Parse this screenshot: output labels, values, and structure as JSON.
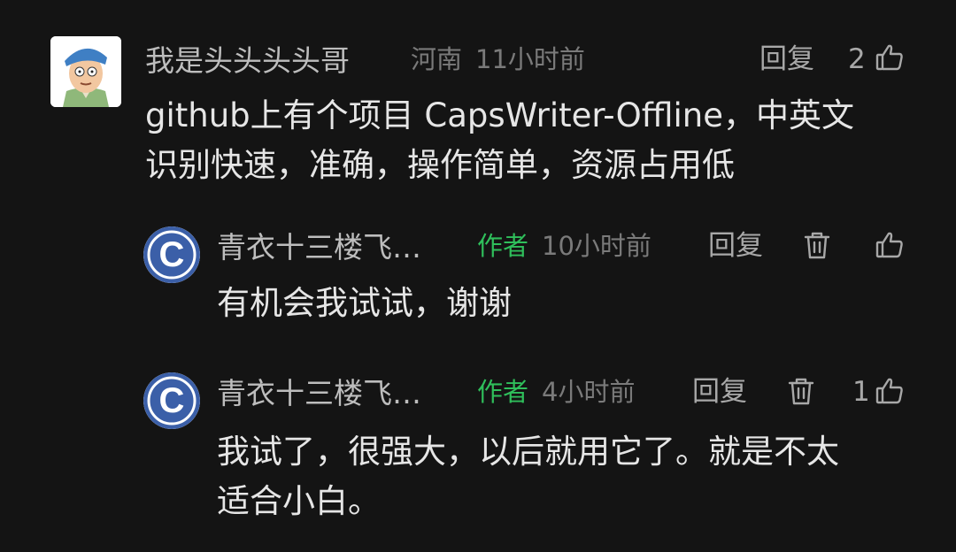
{
  "comment": {
    "username": "我是头头头头哥",
    "location": "河南",
    "time": "11小时前",
    "reply_label": "回复",
    "like_count": "2",
    "content_line1": "github上有个项目 CapsWriter-Offline，中英文",
    "content_line2": "识别快速，准确，操作简单，资源占用低"
  },
  "replies": [
    {
      "username": "青衣十三楼飞…",
      "author_badge": "作者",
      "time": "10小时前",
      "reply_label": "回复",
      "like_count": "",
      "content": "有机会我试试，谢谢"
    },
    {
      "username": "青衣十三楼飞…",
      "author_badge": "作者",
      "time": "4小时前",
      "reply_label": "回复",
      "like_count": "1",
      "content_line1": "我试了，很强大，以后就用它了。就是不太",
      "content_line2": "适合小白。"
    }
  ],
  "colors": {
    "background": "#141414",
    "author_badge": "#2fbf5b",
    "reply_avatar": "#3b5fa8"
  },
  "icons": [
    "thumbs-up-icon",
    "trash-icon",
    "avatar-c-icon"
  ]
}
